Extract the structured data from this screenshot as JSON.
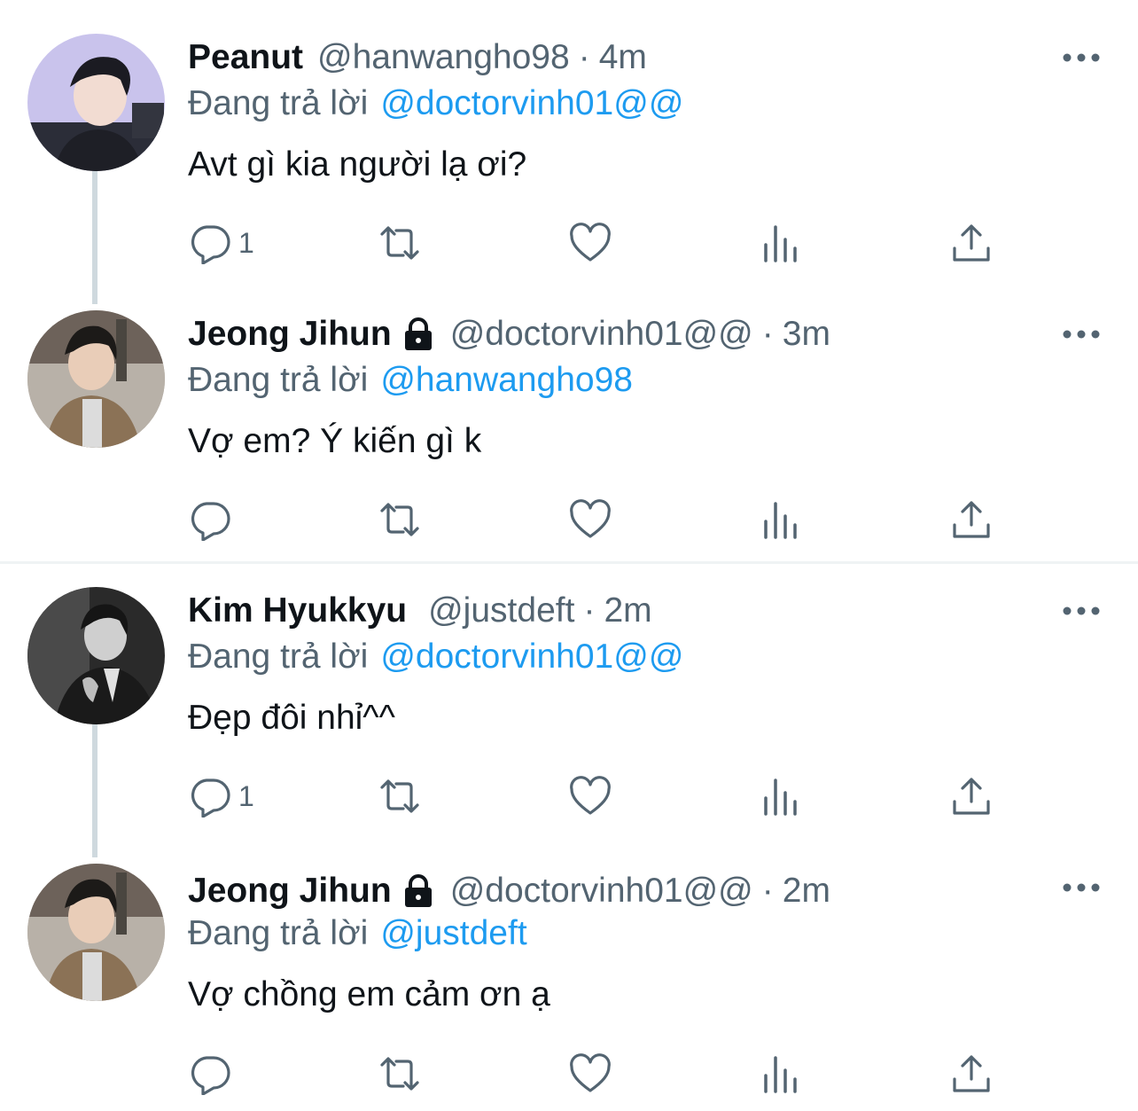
{
  "reply_prefix": "Đang trả lời",
  "colors": {
    "link": "#1d9bf0",
    "secondary": "#536471",
    "thread_line": "#cfd9de"
  },
  "tweets": [
    {
      "name": "Peanut",
      "handle": "@hanwangho98",
      "separator": "·",
      "time": "4m",
      "protected": false,
      "replying_to": "@doctorvinh01@@",
      "text": "Avt gì kia người lạ ơi?",
      "reply_count": "1",
      "avatar": "avatar-photo"
    },
    {
      "name": "Jeong Jihun",
      "handle": "@doctorvinh01@@",
      "separator": "·",
      "time": "3m",
      "protected": true,
      "replying_to": "@hanwangho98",
      "text": "Vợ em? Ý kiến gì k",
      "reply_count": "",
      "avatar": "avatar-photo"
    },
    {
      "name": "Kim Hyukkyu",
      "handle": "@justdeft",
      "separator": "·",
      "time": "2m",
      "protected": false,
      "replying_to": "@doctorvinh01@@",
      "text": "Đẹp đôi nhỉ^^",
      "reply_count": "1",
      "avatar": "avatar-photo"
    },
    {
      "name": "Jeong Jihun",
      "handle": "@doctorvinh01@@",
      "separator": "·",
      "time": "2m",
      "protected": true,
      "replying_to": "@justdeft",
      "text": "Vợ chồng em cảm ơn ạ",
      "reply_count": "",
      "avatar": "avatar-photo"
    }
  ],
  "icons": {
    "reply": "reply-icon",
    "retweet": "retweet-icon",
    "like": "like-icon",
    "views": "views-icon",
    "share": "share-icon",
    "more": "more-icon",
    "lock": "lock-icon"
  }
}
